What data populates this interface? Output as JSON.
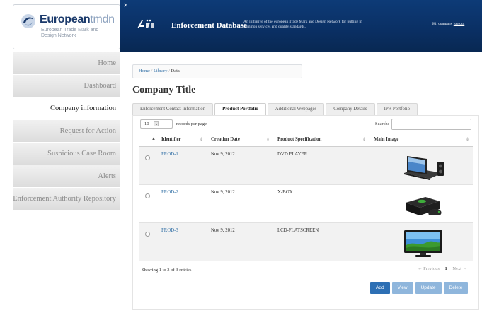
{
  "brand": {
    "name_bold": "European",
    "name_light": "tmdn",
    "subtitle": "European Trade Mark and Design Network"
  },
  "header": {
    "close_glyph": "✕",
    "title": "Enforcement Database",
    "tagline": "An initiative of the european Trade Mark and Design Network for putting in common services and quality standards.",
    "greeting": "Hi, company",
    "logout": "log out"
  },
  "sidebar": {
    "items": [
      {
        "label": "Home",
        "active": false
      },
      {
        "label": "Dashboard",
        "active": false
      },
      {
        "label": "Company information",
        "active": true
      },
      {
        "label": "Request for Action",
        "active": false
      },
      {
        "label": "Suspicious Case Room",
        "active": false
      },
      {
        "label": "Alerts",
        "active": false
      },
      {
        "label": "Enforcement Authority Repository",
        "active": false
      }
    ]
  },
  "breadcrumb": {
    "items": [
      "Home",
      "Library"
    ],
    "current": "Data",
    "separator": "/"
  },
  "page_title": "Company Title",
  "tabs": [
    {
      "label": "Enforcement Contact Information",
      "active": false
    },
    {
      "label": "Product Portfolio",
      "active": true
    },
    {
      "label": "Additional Webpages",
      "active": false
    },
    {
      "label": "Company Details",
      "active": false
    },
    {
      "label": "IPR Portfolio",
      "active": false
    }
  ],
  "table_controls": {
    "records_per_page_value": "10",
    "records_per_page_label": "records per page",
    "search_label": "Search:",
    "search_value": ""
  },
  "table": {
    "columns": [
      "Identifier",
      "Creation Date",
      "Product Specification",
      "Main Image"
    ],
    "rows": [
      {
        "id": "PROD-1",
        "date": "Nov 9, 2012",
        "spec": "DVD PLAYER",
        "image_icon": "dvd-player-image"
      },
      {
        "id": "PROD-2",
        "date": "Nov 9, 2012",
        "spec": "X-BOX",
        "image_icon": "xbox-console-image"
      },
      {
        "id": "PROD-3",
        "date": "Nov 9, 2012",
        "spec": "LCD-FLATSCREEN",
        "image_icon": "lcd-tv-image"
      }
    ],
    "info": "Showing 1 to 3 of 3 entries"
  },
  "pager": {
    "previous": "← Previous",
    "current": "1",
    "next": "Next →"
  },
  "actions": {
    "add": "Add",
    "view": "View",
    "update": "Update",
    "delete": "Delete"
  },
  "colors": {
    "header_bg": "#0a2f63",
    "link": "#2e6da4",
    "primary_button": "#2d6fb4",
    "muted_button": "#8fb6dc"
  }
}
